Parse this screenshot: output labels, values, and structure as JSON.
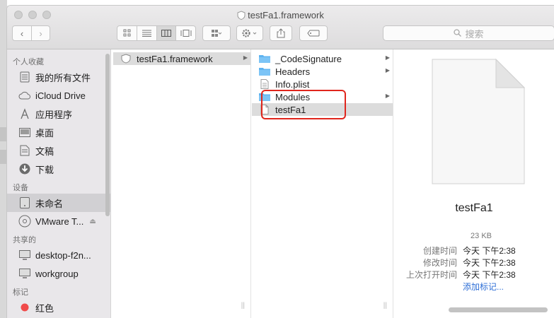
{
  "window": {
    "title": "testFa1.framework"
  },
  "toolbar": {
    "back_icon": "chevron-left-icon",
    "forward_icon": "chevron-right-icon",
    "search_placeholder": "搜索"
  },
  "sidebar": {
    "sections": [
      {
        "title": "个人收藏",
        "items": [
          {
            "label": "我的所有文件",
            "icon": "all-files-icon"
          },
          {
            "label": "iCloud Drive",
            "icon": "cloud-icon"
          },
          {
            "label": "应用程序",
            "icon": "applications-icon"
          },
          {
            "label": "桌面",
            "icon": "desktop-icon"
          },
          {
            "label": "文稿",
            "icon": "documents-icon"
          },
          {
            "label": "下载",
            "icon": "downloads-icon"
          }
        ]
      },
      {
        "title": "设备",
        "items": [
          {
            "label": "未命名",
            "icon": "disk-icon",
            "selected": true
          },
          {
            "label": "VMware T...",
            "icon": "dvd-icon",
            "eject": true
          }
        ]
      },
      {
        "title": "共享的",
        "items": [
          {
            "label": "desktop-f2n...",
            "icon": "computer-icon"
          },
          {
            "label": "workgroup",
            "icon": "computer-icon"
          }
        ]
      },
      {
        "title": "标记",
        "items": [
          {
            "label": "红色",
            "icon": "red-tag-icon",
            "color": "#f04a4a"
          }
        ]
      }
    ]
  },
  "columns": {
    "col1": [
      {
        "label": "testFa1.framework",
        "type": "framework",
        "expand": true,
        "selected": true
      }
    ],
    "col2": [
      {
        "label": "_CodeSignature",
        "type": "folder",
        "expand": true
      },
      {
        "label": "Headers",
        "type": "folder",
        "expand": true
      },
      {
        "label": "Info.plist",
        "type": "plist",
        "expand": false
      },
      {
        "label": "Modules",
        "type": "folder",
        "expand": true
      },
      {
        "label": "testFa1",
        "type": "file",
        "expand": false,
        "selected": true
      }
    ]
  },
  "preview": {
    "name": "testFa1",
    "size": "23 KB",
    "meta": [
      {
        "key": "创建时间",
        "value": "今天 下午2:38"
      },
      {
        "key": "修改时间",
        "value": "今天 下午2:38"
      },
      {
        "key": "上次打开时间",
        "value": "今天 下午2:38"
      }
    ],
    "add_tags": "添加标记..."
  },
  "colors": {
    "accent": "#2d6ed6",
    "highlight_box": "#e0261d",
    "folder": "#5eb3f0"
  }
}
